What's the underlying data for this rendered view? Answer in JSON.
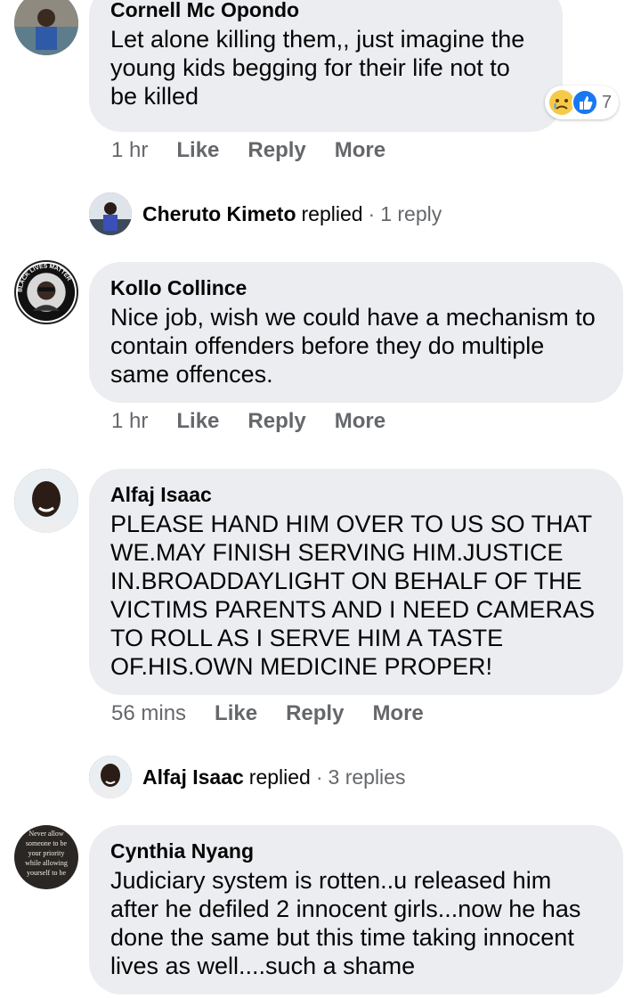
{
  "comments": [
    {
      "author": "Cornell Mc Opondo",
      "text": "Let alone killing them,, just imagine the young kids begging for their life not to be killed",
      "time": "1 hr",
      "like": "Like",
      "reply": "Reply",
      "more": "More",
      "reactions": {
        "icons": [
          "sad-emoji-icon",
          "thumbs-up-icon"
        ],
        "count": "7"
      }
    },
    {
      "author": "Kollo Collince",
      "text": "Nice job, wish we could have a mechanism to contain offenders before they do multiple same offences.",
      "time": "1 hr",
      "like": "Like",
      "reply": "Reply",
      "more": "More",
      "avatar_ring_text": "BLACK LIVES MATTER"
    },
    {
      "author": "Alfaj Isaac",
      "text": "PLEASE HAND HIM OVER TO US SO THAT WE.MAY FINISH SERVING HIM.JUSTICE IN.BROADDAYLIGHT ON BEHALF OF THE VICTIMS PARENTS AND I NEED CAMERAS TO ROLL AS I SERVE HIM A TASTE OF.HIS.OWN MEDICINE PROPER!",
      "time": "56 mins",
      "like": "Like",
      "reply": "Reply",
      "more": "More"
    },
    {
      "author": "Cynthia Nyang",
      "text": "Judiciary system is rotten..u released him after he defiled 2 innocent girls...now he has done the same but this time taking innocent lives as well....such a shame",
      "avatar_image_text": "Never allow someone to be your priority while allowing yourself to be"
    }
  ],
  "replies": [
    {
      "name": "Cheruto Kimeto",
      "verb": "replied",
      "separator": "·",
      "count": "1 reply"
    },
    {
      "name": "Alfaj Isaac",
      "verb": "replied",
      "separator": "·",
      "count": "3 replies"
    }
  ],
  "colors": {
    "bubble": "#ebedf0",
    "secondary_text": "#65676b",
    "like_blue": "#1877f2"
  }
}
